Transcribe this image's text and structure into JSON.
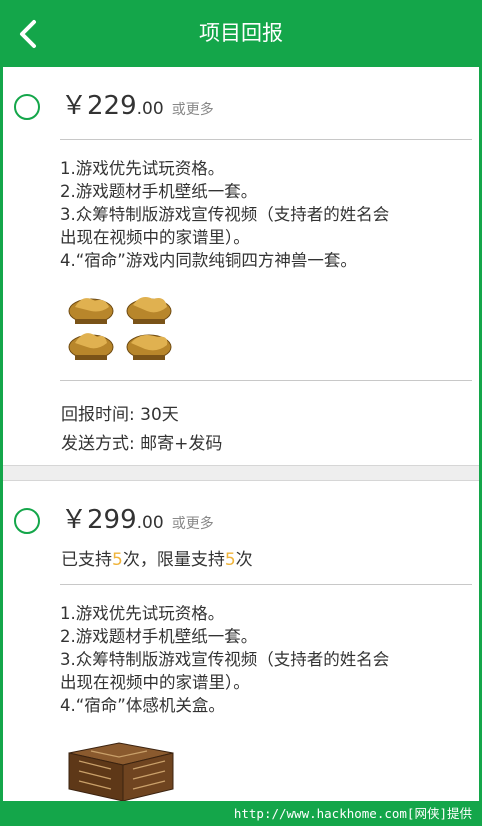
{
  "header": {
    "title": "项目回报"
  },
  "rewards": [
    {
      "currency": "￥",
      "price_int": "229",
      "price_dec": ".00",
      "more": "或更多",
      "items": [
        "1.游戏优先试玩资格。",
        "2.游戏题材手机壁纸一套。",
        "3.众筹特制版游戏宣传视频（支持者的姓名会",
        "出现在视频中的家谱里）。",
        "4.“宿命”游戏内同款纯铜四方神兽一套。"
      ],
      "image_icon": "bronze-beasts-image",
      "time_label": "回报时间: 30天",
      "ship_label": "发送方式: 邮寄+发码"
    },
    {
      "currency": "￥",
      "price_int": "299",
      "price_dec": ".00",
      "more": "或更多",
      "limit_prefix": "已支持",
      "limit_count": "5",
      "limit_mid": "次，限量支持",
      "limit_total": "5",
      "limit_suffix": "次",
      "items": [
        "1.游戏优先试玩资格。",
        "2.游戏题材手机壁纸一套。",
        "3.众筹特制版游戏宣传视频（支持者的姓名会",
        "出现在视频中的家谱里）。",
        "4.“宿命”体感机关盒。"
      ],
      "image_icon": "puzzle-box-image"
    }
  ],
  "watermark": "http://www.hackhome.com[网侠]提供",
  "colors": {
    "brand": "#14a64a",
    "highlight": "#f0b43a"
  }
}
